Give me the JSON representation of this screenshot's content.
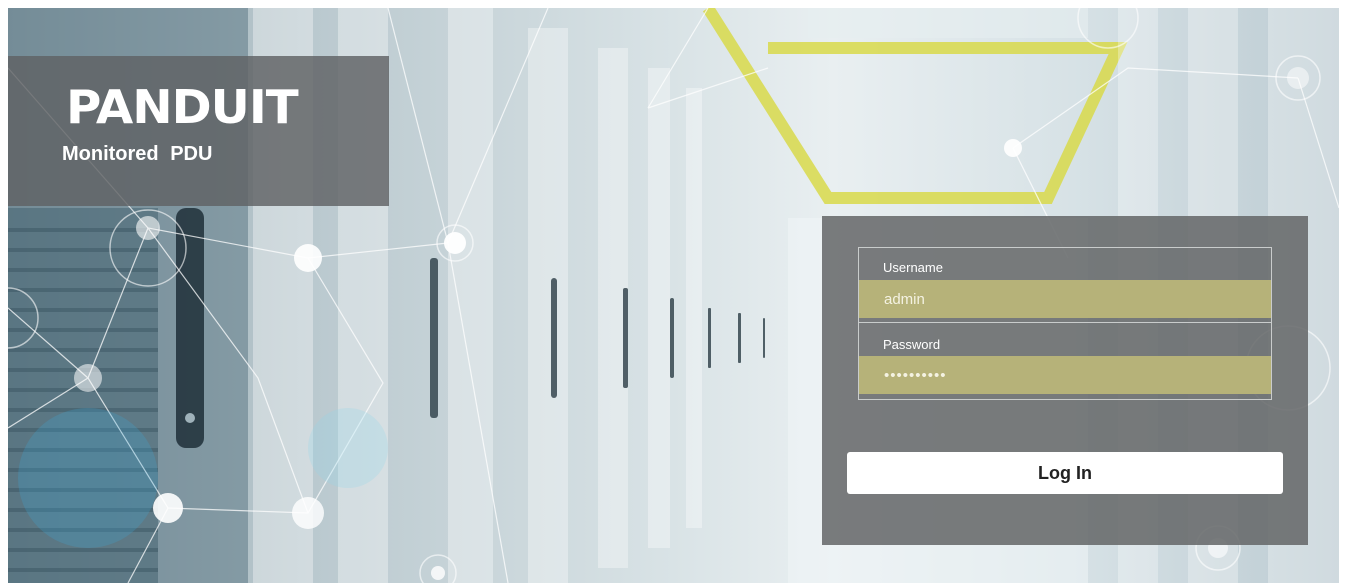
{
  "brand": {
    "logo_text": "PANDUIT",
    "product_name": "Monitored PDU"
  },
  "login": {
    "username_label": "Username",
    "username_value": "admin",
    "password_label": "Password",
    "password_value": "••••••••••",
    "submit_label": "Log In"
  },
  "colors": {
    "input_fill": "#b6b279",
    "panel_fill": "#646668",
    "button_fill": "#ffffff"
  }
}
